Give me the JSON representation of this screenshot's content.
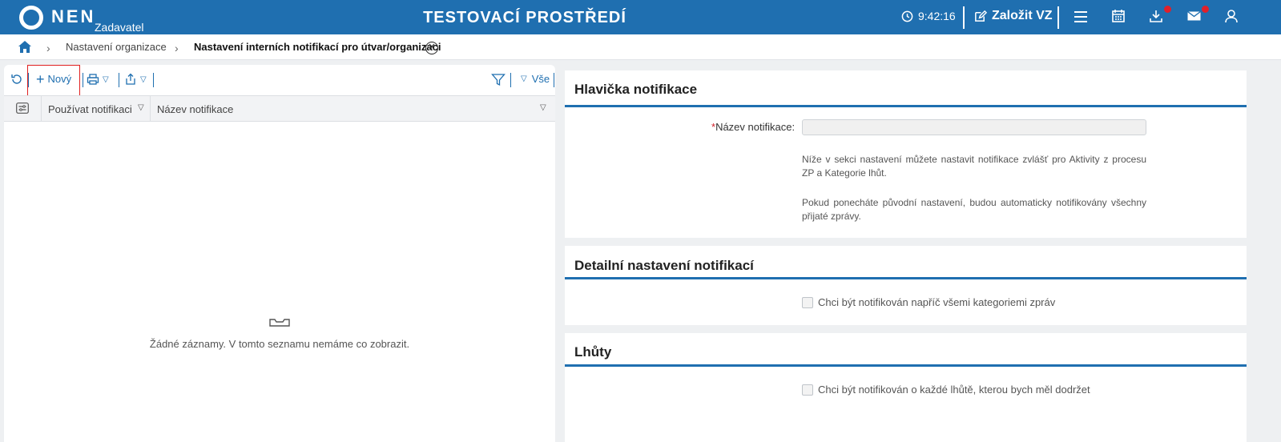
{
  "header": {
    "logo_text": "NEN",
    "logo_sub": "Zadavatel",
    "environment_title": "TESTOVACÍ PROSTŘEDÍ",
    "clock": "9:42:16",
    "create_label": "Založit VZ"
  },
  "breadcrumb": {
    "items": [
      "Nastavení organizace",
      "Nastavení interních notifikací pro útvar/organizaci"
    ]
  },
  "list": {
    "toolbar": {
      "new_label": "Nový",
      "filter_all_label": "Vše"
    },
    "columns": [
      "Používat notifikaci",
      "Název notifikace"
    ],
    "empty_text": "Žádné záznamy. V tomto seznamu nemáme co zobrazit."
  },
  "detail": {
    "header_section": {
      "title": "Hlavička notifikace",
      "name_label": "Název notifikace",
      "name_value": "",
      "note1": "Níže v sekci nastavení můžete nastavit notifikace zvlášť pro Aktivity z procesu ZP a Kategorie lhůt.",
      "note2": "Pokud ponecháte původní nastavení, budou automaticky notifikovány všechny přijaté zprávy."
    },
    "detail_section": {
      "title": "Detailní nastavení notifikací",
      "checkbox_label": "Chci být notifikován napříč všemi kategoriemi zpráv"
    },
    "deadlines_section": {
      "title": "Lhůty",
      "checkbox_label": "Chci být notifikován o každé lhůtě, kterou bych měl dodržet"
    }
  },
  "colors": {
    "brand": "#1f6fb0",
    "badge": "#e0202a"
  }
}
